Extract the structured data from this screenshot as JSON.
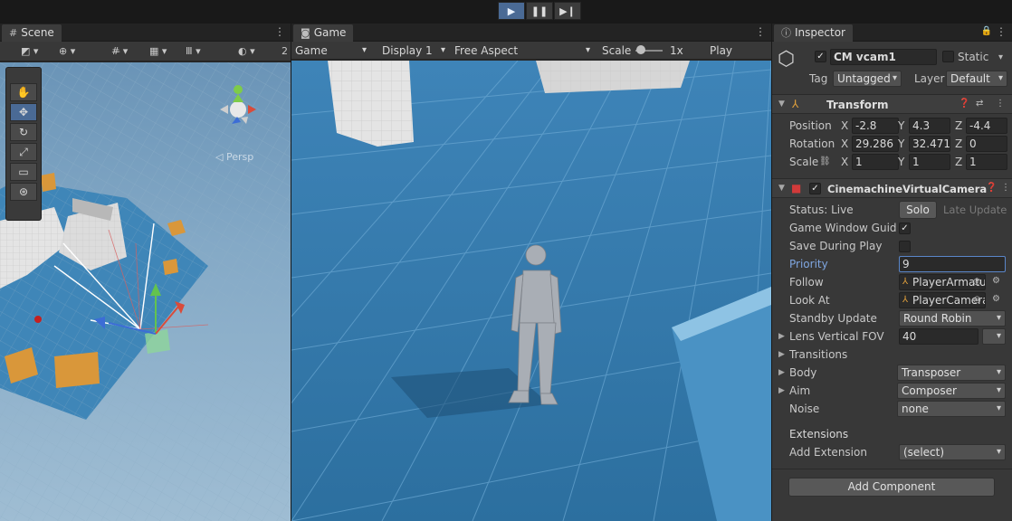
{
  "playbar": {
    "play_icon": "play-icon",
    "pause_icon": "pause-icon",
    "step_icon": "step-icon"
  },
  "scene": {
    "tab_label": "Scene",
    "toolbar_extra": "2",
    "persp_label": "◁ Persp"
  },
  "game": {
    "tab_label": "Game",
    "mode": "Game",
    "display": "Display 1",
    "aspect": "Free Aspect",
    "scale_label": "Scale",
    "scale_value": "1x",
    "play_focus": "Play Focuse"
  },
  "inspector": {
    "tab_label": "Inspector",
    "object_name": "CM vcam1",
    "static_label": "Static",
    "tag_label": "Tag",
    "tag_value": "Untagged",
    "layer_label": "Layer",
    "layer_value": "Default",
    "transform": {
      "title": "Transform",
      "position_label": "Position",
      "rotation_label": "Rotation",
      "scale_label": "Scale",
      "axis_x": "X",
      "axis_y": "Y",
      "axis_z": "Z",
      "position": {
        "x": "-2.8",
        "y": "4.3",
        "z": "-4.4"
      },
      "rotation": {
        "x": "29.286",
        "y": "32.471",
        "z": "0"
      },
      "scale": {
        "x": "1",
        "y": "1",
        "z": "1"
      }
    },
    "vcam": {
      "title": "CinemachineVirtualCamera",
      "status_label": "Status: Live",
      "solo_label": "Solo",
      "late_update_label": "Late Update",
      "game_window_guides_label": "Game Window Guides",
      "save_during_play_label": "Save During Play",
      "priority_label": "Priority",
      "priority_value": "9",
      "follow_label": "Follow",
      "follow_value": "PlayerArmature",
      "look_at_label": "Look At",
      "look_at_value": "PlayerCameraRoot",
      "standby_update_label": "Standby Update",
      "standby_update_value": "Round Robin",
      "lens_label": "Lens Vertical FOV",
      "lens_value": "40",
      "transitions_label": "Transitions",
      "body_label": "Body",
      "body_value": "Transposer",
      "aim_label": "Aim",
      "aim_value": "Composer",
      "noise_label": "Noise",
      "noise_value": "none"
    },
    "extensions_title": "Extensions",
    "add_extension_label": "Add Extension",
    "add_extension_value": "(select)",
    "add_component_label": "Add Component"
  }
}
